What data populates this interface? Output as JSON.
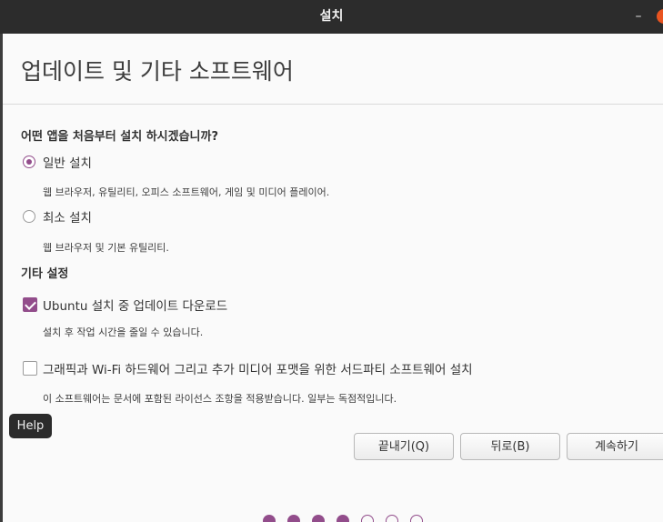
{
  "window": {
    "title": "설치",
    "minimize_glyph": "–"
  },
  "page": {
    "heading": "업데이트 및 기타 소프트웨어"
  },
  "install_type": {
    "question": "어떤 앱을 처음부터 설치 하시겠습니까?",
    "options": [
      {
        "label": "일반 설치",
        "description": "웹 브라우저, 유틸리티, 오피스  소프트웨어, 게임 및 미디어 플레이어.",
        "selected": true
      },
      {
        "label": "최소 설치",
        "description": "웹 브라우저 및 기본 유틸리티.",
        "selected": false
      }
    ]
  },
  "other_settings": {
    "heading": "기타 설정",
    "options": [
      {
        "label": "Ubuntu 설치 중 업데이트 다운로드",
        "description": "설치 후 작업 시간을 줄일 수 있습니다.",
        "checked": true
      },
      {
        "label": "그래픽과 Wi-Fi 하드웨어 그리고 추가 미디어 포맷을 위한 서드파티 소프트웨어 설치",
        "description": "이 소프트웨어는 문서에 포함된 라이선스 조항을 적용받습니다. 일부는 독점적입니다.",
        "checked": false
      }
    ]
  },
  "help_tooltip": "Help",
  "buttons": {
    "quit": "끝내기(Q)",
    "back": "뒤로(B)",
    "continue": "계속하기"
  },
  "progress": {
    "total_steps": 7,
    "completed_steps": 4
  },
  "colors": {
    "accent": "#924d8b",
    "close": "#e95420",
    "titlebar": "#2c2c2c"
  }
}
